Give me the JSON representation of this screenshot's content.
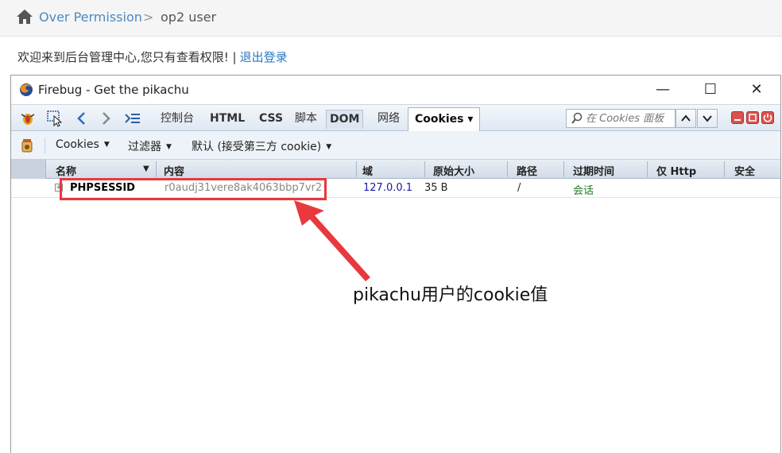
{
  "breadcrumb": {
    "link": "Over Permission",
    "separator": ">",
    "current": "op2 user"
  },
  "welcome": {
    "text": "欢迎来到后台管理中心,您只有查看权限! |",
    "logout": "退出登录"
  },
  "window": {
    "title": "Firebug - Get the pikachu",
    "minimize": "—",
    "maximize": "☐",
    "close": "✕"
  },
  "tabs": {
    "console": "控制台",
    "html": "HTML",
    "css": "CSS",
    "script": "脚本",
    "dom": "DOM",
    "net": "网络",
    "cookies": "Cookies ▾"
  },
  "search": {
    "placeholder": "在 Cookies 面板"
  },
  "toolbar2": {
    "cookies": "Cookies",
    "filter": "过滤器",
    "default": "默认 (接受第三方 cookie)"
  },
  "columns": {
    "name": "名称",
    "sort": "▼",
    "content": "内容",
    "domain": "域",
    "raw_size": "原始大小",
    "path": "路径",
    "expires": "过期时间",
    "http_only": "仅 Http",
    "secure": "安全"
  },
  "cookie_row": {
    "name": "PHPSESSID",
    "content": "r0audj31vere8ak4063bbp7vr2",
    "domain": "127.0.0.1",
    "size": "35 B",
    "path": "/",
    "expires": "会话"
  },
  "annotation": "pikachu用户的cookie值",
  "colors": {
    "highlight": "#e8393f",
    "link": "#2b78c5",
    "domain_text": "#1a1aa6",
    "session_text": "#1d7a1d"
  }
}
